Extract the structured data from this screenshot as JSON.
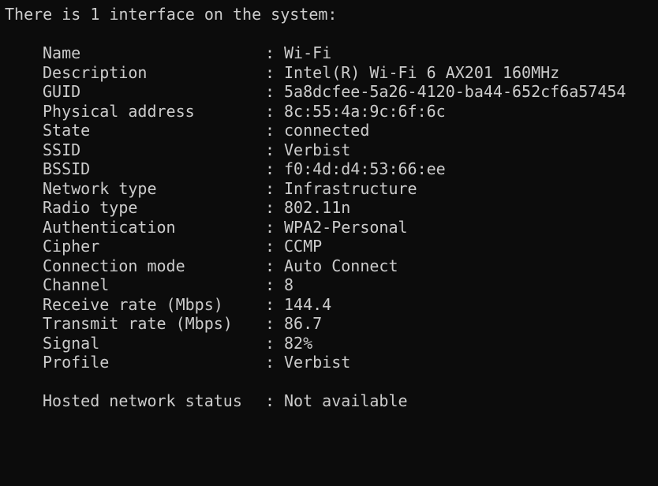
{
  "window": {
    "background": "#0c0c0c",
    "text_color": "#cccccc"
  },
  "header": "There is 1 interface on the system:",
  "interface": [
    {
      "key": "Name",
      "value": "Wi-Fi"
    },
    {
      "key": "Description",
      "value": "Intel(R) Wi-Fi 6 AX201 160MHz"
    },
    {
      "key": "GUID",
      "value": "5a8dcfee-5a26-4120-ba44-652cf6a57454"
    },
    {
      "key": "Physical address",
      "value": "8c:55:4a:9c:6f:6c"
    },
    {
      "key": "State",
      "value": "connected"
    },
    {
      "key": "SSID",
      "value": "Verbist"
    },
    {
      "key": "BSSID",
      "value": "f0:4d:d4:53:66:ee"
    },
    {
      "key": "Network type",
      "value": "Infrastructure"
    },
    {
      "key": "Radio type",
      "value": "802.11n"
    },
    {
      "key": "Authentication",
      "value": "WPA2-Personal"
    },
    {
      "key": "Cipher",
      "value": "CCMP"
    },
    {
      "key": "Connection mode",
      "value": "Auto Connect"
    },
    {
      "key": "Channel",
      "value": "8"
    },
    {
      "key": "Receive rate (Mbps)",
      "value": "144.4"
    },
    {
      "key": "Transmit rate (Mbps)",
      "value": "86.7"
    },
    {
      "key": "Signal",
      "value": "82%"
    },
    {
      "key": "Profile",
      "value": "Verbist"
    }
  ],
  "hosted": {
    "key": "Hosted network status",
    "value": "Not available"
  },
  "separator": ":"
}
